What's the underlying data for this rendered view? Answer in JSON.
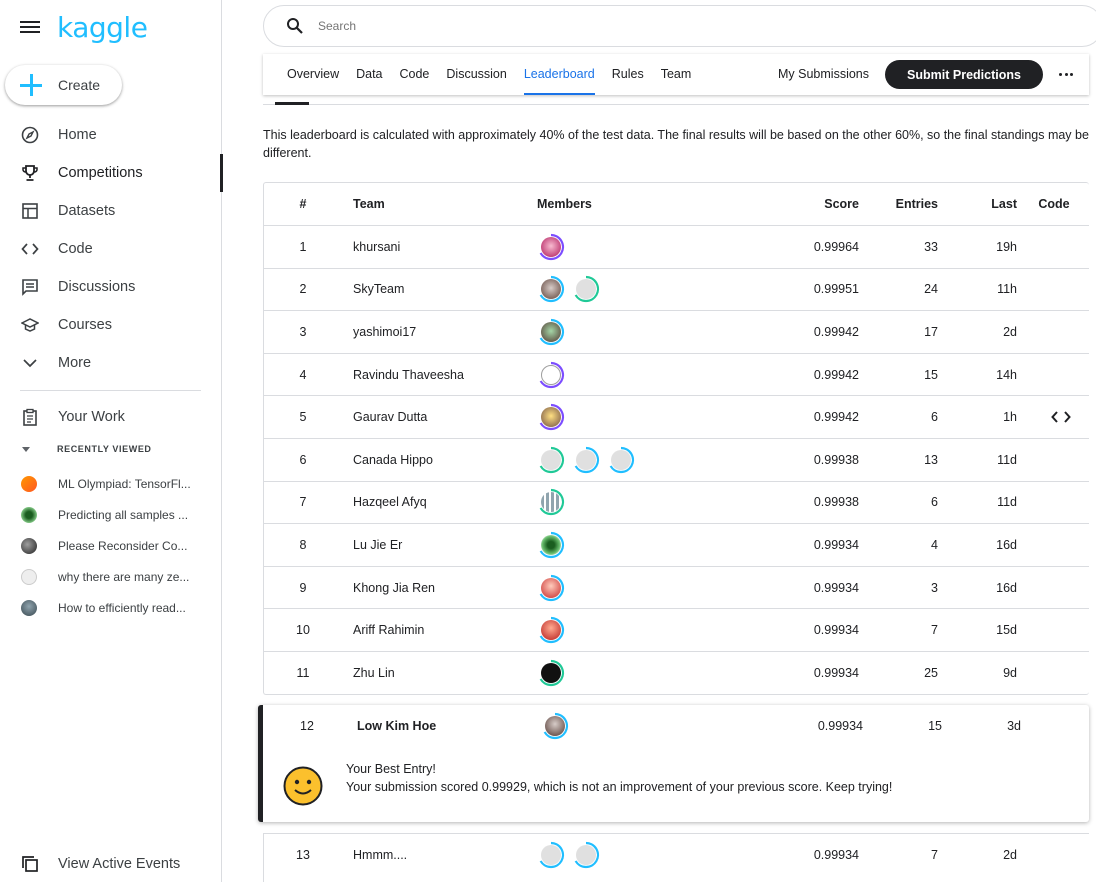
{
  "brand": "kaggle",
  "sidebar": {
    "create_label": "Create",
    "nav": [
      {
        "label": "Home",
        "icon": "compass-icon"
      },
      {
        "label": "Competitions",
        "icon": "trophy-icon"
      },
      {
        "label": "Datasets",
        "icon": "table-icon"
      },
      {
        "label": "Code",
        "icon": "code-icon"
      },
      {
        "label": "Discussions",
        "icon": "comment-icon"
      },
      {
        "label": "Courses",
        "icon": "school-icon"
      },
      {
        "label": "More",
        "icon": "chevron-down-icon"
      }
    ],
    "your_work": "Your Work",
    "recently_viewed_title": "RECENTLY VIEWED",
    "recent": [
      {
        "label": "ML Olympiad: TensorFl...",
        "color": "#f57c00"
      },
      {
        "label": "Predicting all samples ...",
        "color": "#2e7d32"
      },
      {
        "label": "Please Reconsider Co...",
        "color": "#424242"
      },
      {
        "label": "why there are many ze...",
        "color": "#e0e0e0"
      },
      {
        "label": "How to efficiently read...",
        "color": "#607d8b"
      }
    ],
    "view_events": "View Active Events"
  },
  "search": {
    "placeholder": "Search"
  },
  "tabs": [
    "Overview",
    "Data",
    "Code",
    "Discussion",
    "Leaderboard",
    "Rules",
    "Team"
  ],
  "active_tab": "Leaderboard",
  "my_submissions": "My Submissions",
  "submit_predictions": "Submit Predictions",
  "note": "This leaderboard is calculated with approximately 40% of the test data. The final results will be based on the other 60%, so the final standings may be different.",
  "table": {
    "headers": {
      "rank": "#",
      "team": "Team",
      "members": "Members",
      "score": "Score",
      "entries": "Entries",
      "last": "Last",
      "code": "Code"
    },
    "rows": [
      {
        "rank": "1",
        "team": "khursani",
        "score": "0.99964",
        "entries": "33",
        "last": "19h"
      },
      {
        "rank": "2",
        "team": "SkyTeam",
        "score": "0.99951",
        "entries": "24",
        "last": "11h"
      },
      {
        "rank": "3",
        "team": "yashimoi17",
        "score": "0.99942",
        "entries": "17",
        "last": "2d"
      },
      {
        "rank": "4",
        "team": "Ravindu Thaveesha",
        "score": "0.99942",
        "entries": "15",
        "last": "14h"
      },
      {
        "rank": "5",
        "team": "Gaurav Dutta",
        "score": "0.99942",
        "entries": "6",
        "last": "1h"
      },
      {
        "rank": "6",
        "team": "Canada Hippo",
        "score": "0.99938",
        "entries": "13",
        "last": "11d"
      },
      {
        "rank": "7",
        "team": "Hazqeel Afyq",
        "score": "0.99938",
        "entries": "6",
        "last": "11d"
      },
      {
        "rank": "8",
        "team": "Lu Jie Er",
        "score": "0.99934",
        "entries": "4",
        "last": "16d"
      },
      {
        "rank": "9",
        "team": "Khong Jia Ren",
        "score": "0.99934",
        "entries": "3",
        "last": "16d"
      },
      {
        "rank": "10",
        "team": "Ariff Rahimin",
        "score": "0.99934",
        "entries": "7",
        "last": "15d"
      },
      {
        "rank": "11",
        "team": "Zhu Lin",
        "score": "0.99934",
        "entries": "25",
        "last": "9d"
      }
    ],
    "my_entry": {
      "rank": "12",
      "team": "Low Kim Hoe",
      "score": "0.99934",
      "entries": "15",
      "last": "3d"
    },
    "after": {
      "rank": "13",
      "team": "Hmmm....",
      "score": "0.99934",
      "entries": "7",
      "last": "2d"
    }
  },
  "best_entry": {
    "title": "Your Best Entry!",
    "message": "Your submission scored 0.99929, which is not an improvement of your previous score. Keep trying!"
  },
  "colors": {
    "accent": "#20beff",
    "link": "#1a73e8",
    "tier_purple": "#7c4dff",
    "tier_blue": "#20beff",
    "tier_green": "#20c997"
  }
}
